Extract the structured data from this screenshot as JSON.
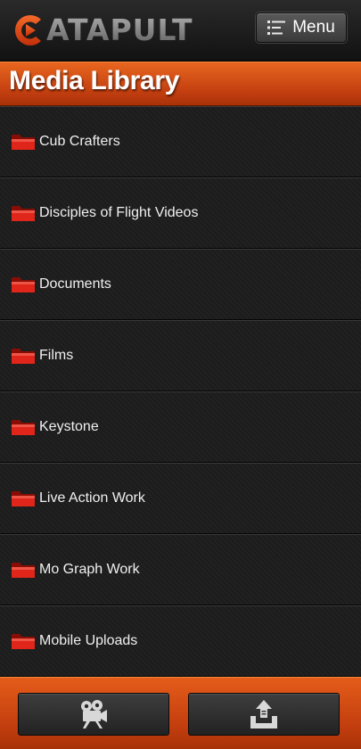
{
  "header": {
    "logo_text": "ATAPULT",
    "logo_initial": "C",
    "menu_label": "Menu",
    "menu_icon": "list-menu-icon"
  },
  "page": {
    "title": "Media Library"
  },
  "folders": [
    {
      "label": "Cub Crafters",
      "icon": "folder-icon"
    },
    {
      "label": "Disciples of Flight Videos",
      "icon": "folder-icon"
    },
    {
      "label": "Documents",
      "icon": "folder-icon"
    },
    {
      "label": "Films",
      "icon": "folder-icon"
    },
    {
      "label": "Keystone",
      "icon": "folder-icon"
    },
    {
      "label": "Live Action Work",
      "icon": "folder-icon"
    },
    {
      "label": "Mo Graph Work",
      "icon": "folder-icon"
    },
    {
      "label": "Mobile Uploads",
      "icon": "folder-icon"
    }
  ],
  "footer": {
    "video_icon": "video-camera-icon",
    "upload_icon": "upload-tray-icon"
  },
  "colors": {
    "accent": "#d24a12",
    "header_bg": "#1a1a1a",
    "list_bg": "#1c1c1c",
    "folder": "#d61f10",
    "text": "#f0f0f0"
  }
}
